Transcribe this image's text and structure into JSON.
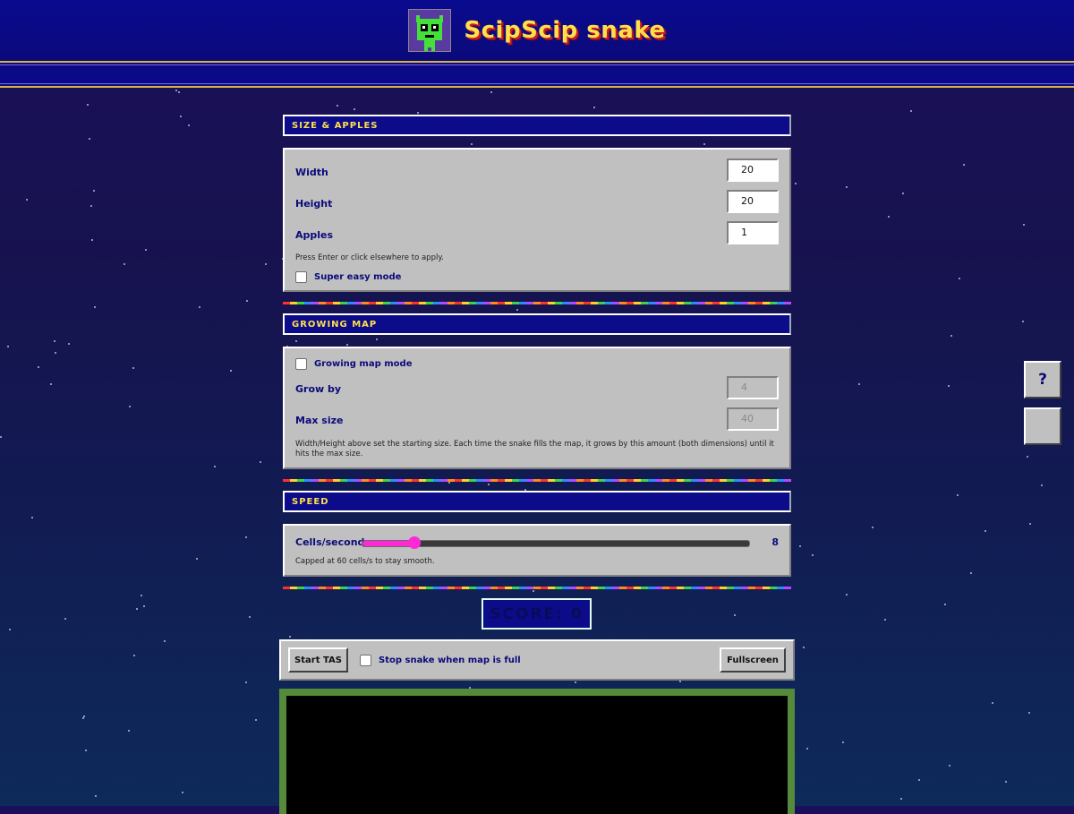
{
  "header": {
    "title": "ScipScip snake",
    "logo_icon": "alien-logo-icon"
  },
  "size_apples": {
    "heading": "SIZE & APPLES",
    "width_label": "Width",
    "width_value": "20",
    "height_label": "Height",
    "height_value": "20",
    "apples_label": "Apples",
    "apples_value": "1",
    "hint": "Press Enter or click elsewhere to apply.",
    "super_easy_label": "Super easy mode",
    "super_easy_checked": false
  },
  "growing_map": {
    "heading": "GROWING MAP",
    "mode_label": "Growing map mode",
    "mode_checked": false,
    "grow_by_label": "Grow by",
    "grow_by_value": "4",
    "max_size_label": "Max size",
    "max_size_value": "40",
    "hint": "Width/Height above set the starting size. Each time the snake fills the map, it grows by this amount (both dimensions) until it hits the max size."
  },
  "speed": {
    "heading": "SPEED",
    "label": "Cells/second",
    "value": "8",
    "slider_fraction": 0.135,
    "hint": "Capped at 60 cells/s to stay smooth."
  },
  "score": {
    "text": "SCORE: 0"
  },
  "toolbar": {
    "start_tas_label": "Start TAS",
    "stop_snake_label": "Stop snake when map is full",
    "stop_snake_checked": false,
    "fullscreen_label": "Fullscreen"
  },
  "side_buttons": {
    "help_label": "?"
  },
  "colors": {
    "accent": "#ffe04a",
    "panel": "#c0c0c0",
    "navy": "#0c0c8a",
    "slider": "#ff2ad6",
    "frame": "#558a3a"
  }
}
